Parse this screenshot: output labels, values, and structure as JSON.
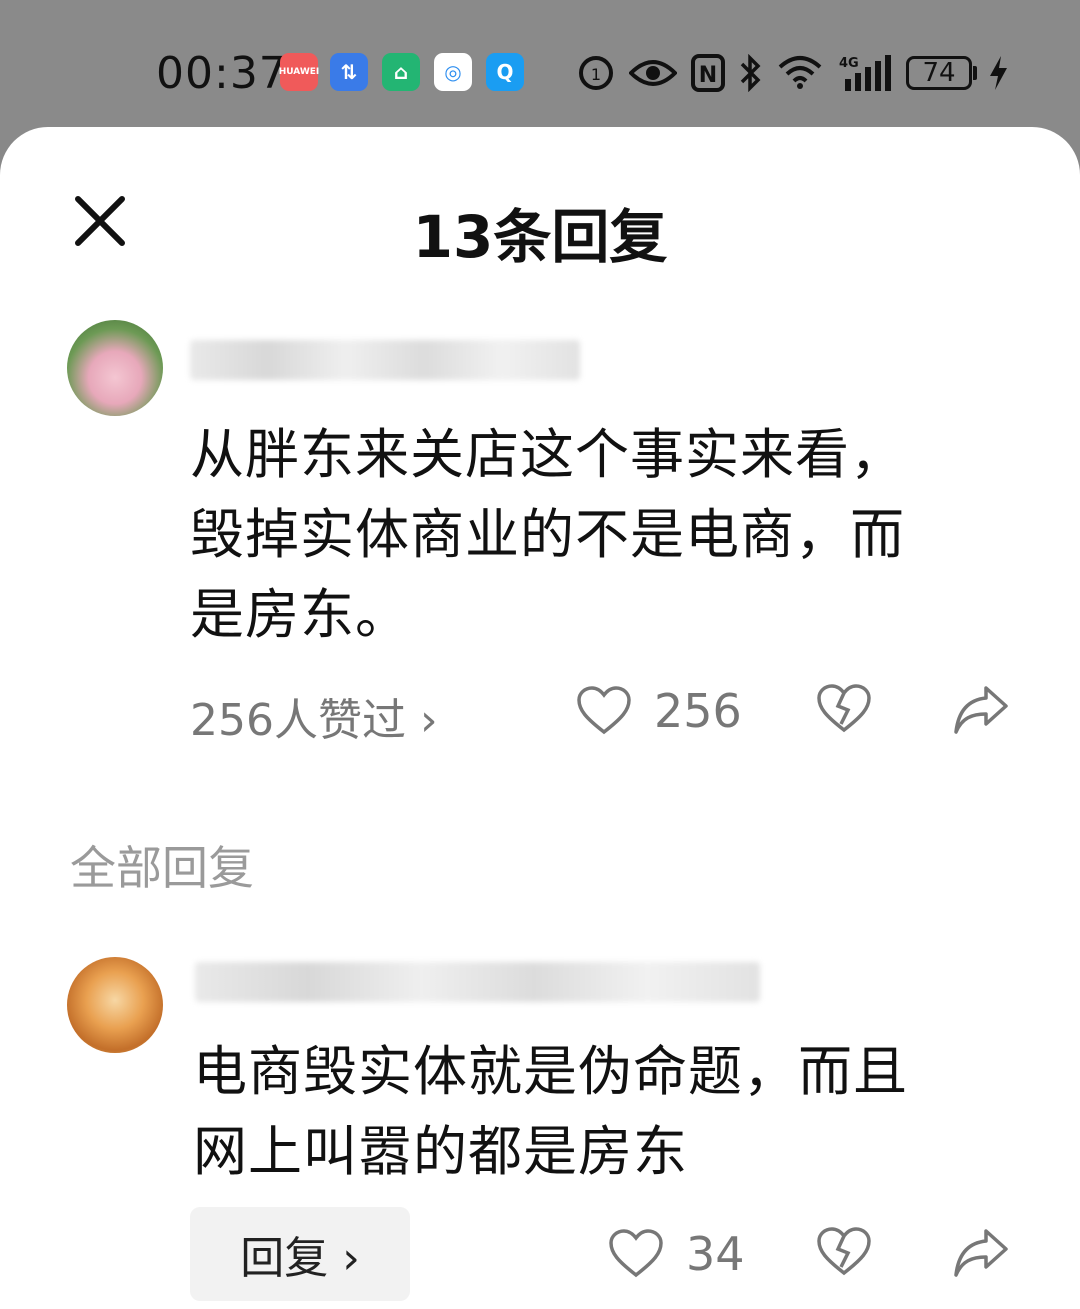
{
  "status_bar": {
    "time": "00:37",
    "battery": "74",
    "network": "4G",
    "apps": [
      {
        "name": "huawei-appgallery-icon",
        "label": "HUAWEI",
        "color": "#f05a5a"
      },
      {
        "name": "transfer-app-icon",
        "label": "⇅",
        "color": "#3a7be8"
      },
      {
        "name": "mi-home-app-icon",
        "label": "⌂",
        "color": "#23b573"
      },
      {
        "name": "browser-app-icon",
        "label": "◎",
        "color": "#2f8ff0"
      },
      {
        "name": "search-app-icon",
        "label": "Q",
        "color": "#1a9df2"
      }
    ]
  },
  "sheet": {
    "title": "13条回复"
  },
  "main_comment": {
    "text": "从胖东来关店这个事实来看，\n毁掉实体商业的不是电商，而\n是房东。",
    "liked_by": "256人赞过 ›",
    "like_count": "256"
  },
  "section_label": "全部回复",
  "replies": [
    {
      "text": "电商毁实体就是伪命题，而且\n网上叫嚣的都是房东",
      "reply_label": "回复 ›",
      "like_count": "34"
    }
  ],
  "colors": {
    "sheet_bg": "#ffffff",
    "status_bg": "#8a8a8a",
    "text_primary": "#111111",
    "text_secondary": "#777777"
  }
}
